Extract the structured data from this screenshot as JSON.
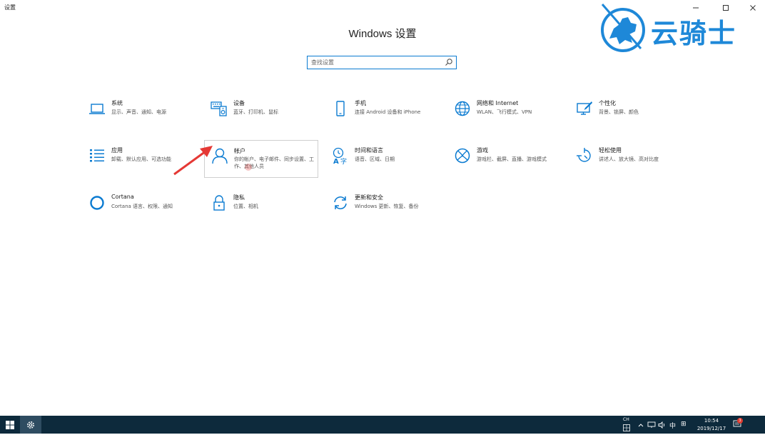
{
  "window": {
    "title": "设置"
  },
  "watermark": {
    "text": "云骑士"
  },
  "page": {
    "title": "Windows 设置"
  },
  "search": {
    "placeholder": "查找设置"
  },
  "tiles": [
    {
      "name": "系统",
      "desc": "显示、声音、通知、电源",
      "icon": "laptop-icon"
    },
    {
      "name": "设备",
      "desc": "蓝牙、打印机、鼠标",
      "icon": "keyboard-speaker-icon"
    },
    {
      "name": "手机",
      "desc": "连接 Android 设备和 iPhone",
      "icon": "phone-icon"
    },
    {
      "name": "网络和 Internet",
      "desc": "WLAN、飞行模式、VPN",
      "icon": "globe-icon"
    },
    {
      "name": "个性化",
      "desc": "背景、锁屏、颜色",
      "icon": "paintbrush-icon"
    },
    {
      "name": "应用",
      "desc": "卸载、默认应用、可选功能",
      "icon": "apps-list-icon"
    },
    {
      "name": "帐户",
      "desc": "你的帐户、电子邮件、同步设置、工作、其他人员",
      "icon": "person-icon"
    },
    {
      "name": "时间和语言",
      "desc": "语音、区域、日期",
      "icon": "time-language-icon"
    },
    {
      "name": "游戏",
      "desc": "游戏栏、截屏、直播、游戏模式",
      "icon": "xbox-icon"
    },
    {
      "name": "轻松使用",
      "desc": "讲述人、放大镜、高对比度",
      "icon": "ease-of-access-icon"
    },
    {
      "name": "Cortana",
      "desc": "Cortana 语言、权限、通知",
      "icon": "cortana-icon"
    },
    {
      "name": "隐私",
      "desc": "位置、相机",
      "icon": "lock-icon"
    },
    {
      "name": "更新和安全",
      "desc": "Windows 更新、恢复、备份",
      "icon": "sync-icon"
    }
  ],
  "taskbar": {
    "ime_label": "CH",
    "ime_mode": "中",
    "ime_extra": "⊞",
    "time": "10:54",
    "date": "2019/12/17",
    "notification_count": "3"
  },
  "colors": {
    "accent": "#0b7bd1",
    "taskbar": "#0d2a3c",
    "watermark": "#1e88d8"
  }
}
